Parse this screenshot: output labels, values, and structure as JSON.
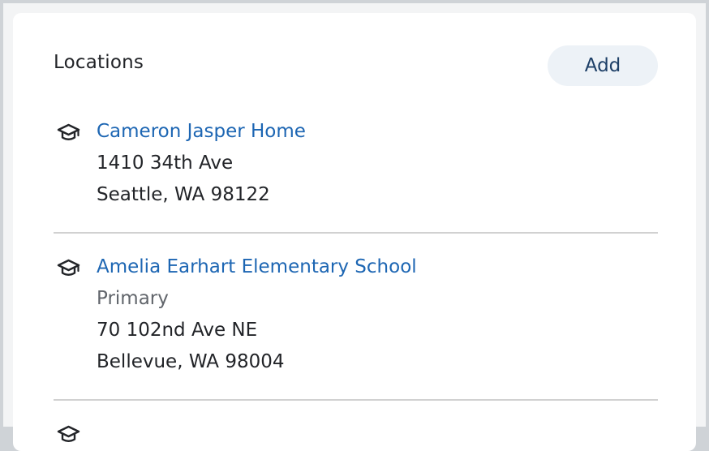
{
  "locations_card": {
    "title": "Locations",
    "add_label": "Add",
    "items": [
      {
        "icon": "graduation-cap-icon",
        "name": "Cameron Jasper Home",
        "address_line1": "1410 34th Ave",
        "address_line2": "Seattle, WA 98122"
      },
      {
        "icon": "graduation-cap-icon",
        "name": "Amelia Earhart Elementary School",
        "tag": "Primary",
        "address_line1": "70 102nd Ave NE",
        "address_line2": "Bellevue, WA 98004"
      }
    ]
  }
}
